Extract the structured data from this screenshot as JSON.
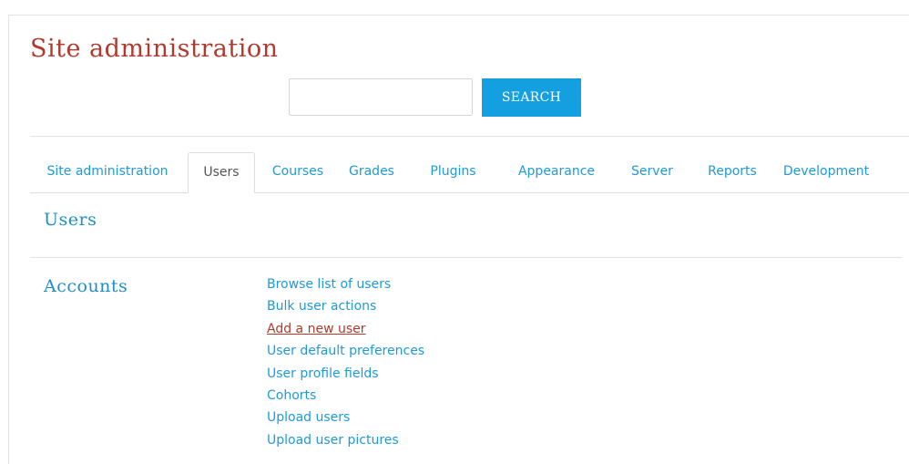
{
  "header": {
    "title": "Site administration"
  },
  "search": {
    "value": "",
    "placeholder": "",
    "button_label": "SEARCH"
  },
  "tabs": [
    {
      "label": "Site administration",
      "active": false
    },
    {
      "label": "Users",
      "active": true
    },
    {
      "label": "Courses",
      "active": false
    },
    {
      "label": "Grades",
      "active": false
    },
    {
      "label": "Plugins",
      "active": false
    },
    {
      "label": "Appearance",
      "active": false
    },
    {
      "label": "Server",
      "active": false
    },
    {
      "label": "Reports",
      "active": false
    },
    {
      "label": "Development",
      "active": false
    }
  ],
  "main": {
    "section_title": "Users",
    "accounts": {
      "heading": "Accounts",
      "links": [
        {
          "label": "Browse list of users",
          "hovered": false
        },
        {
          "label": "Bulk user actions",
          "hovered": false
        },
        {
          "label": "Add a new user",
          "hovered": true
        },
        {
          "label": "User default preferences",
          "hovered": false
        },
        {
          "label": "User profile fields",
          "hovered": false
        },
        {
          "label": "Cohorts",
          "hovered": false
        },
        {
          "label": "Upload users",
          "hovered": false
        },
        {
          "label": "Upload user pictures",
          "hovered": false
        }
      ]
    }
  },
  "colors": {
    "title": "#b03a2e",
    "link": "#1e9ad6",
    "link_hover": "#b03a2e",
    "button": "#14a0e0",
    "heading": "#1e8fc6"
  }
}
